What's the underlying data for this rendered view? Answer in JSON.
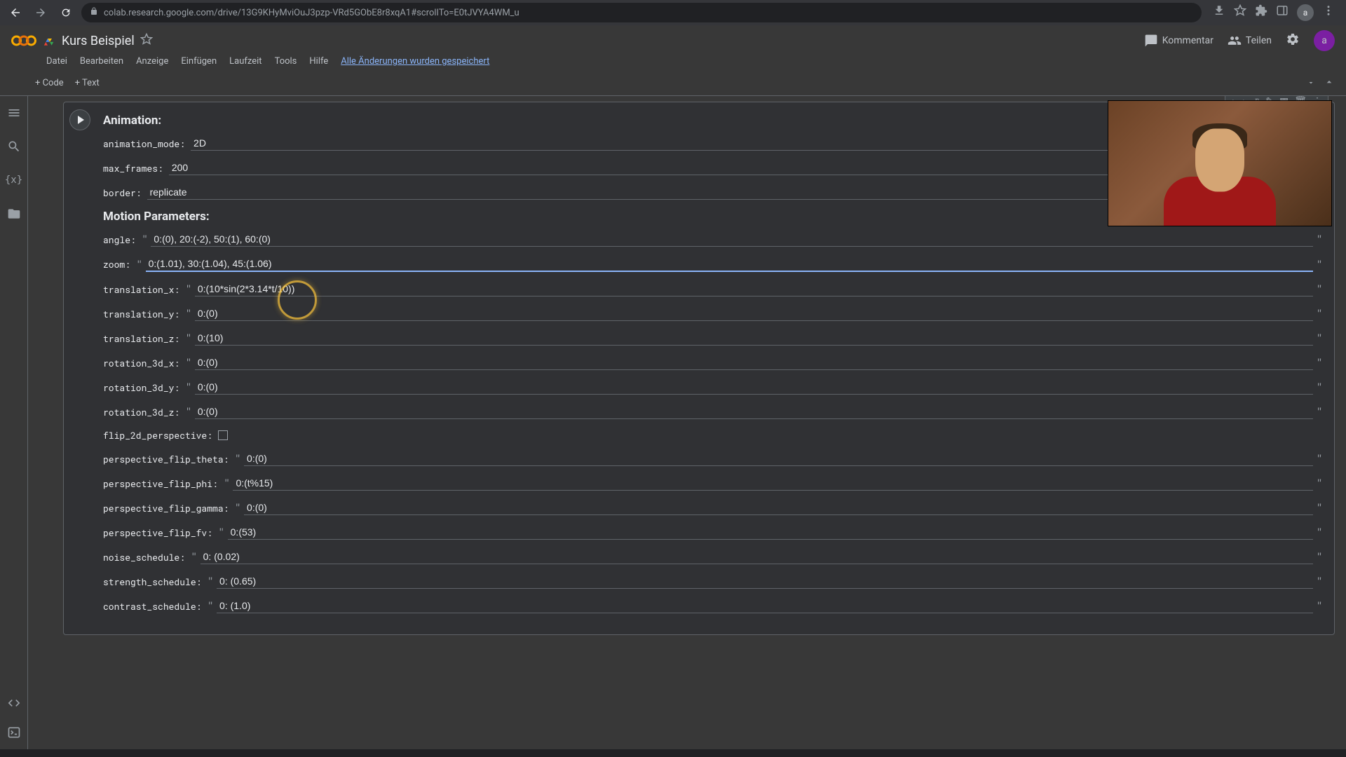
{
  "browser": {
    "url": "colab.research.google.com/drive/13G9KHyMviOuJ3pzp-VRd5GObE8r8xqA1#scrollTo=E0tJVYA4WM_u",
    "avatar": "a"
  },
  "header": {
    "title": "Kurs Beispiel",
    "menus": [
      "Datei",
      "Bearbeiten",
      "Anzeige",
      "Einfügen",
      "Laufzeit",
      "Tools",
      "Hilfe"
    ],
    "saved_text": "Alle Änderungen wurden gespeichert",
    "comment": "Kommentar",
    "share": "Teilen",
    "user": "a"
  },
  "toolbar": {
    "code": "+ Code",
    "text": "+ Text"
  },
  "cell": {
    "section1": "Animation:",
    "section2": "Motion Parameters:",
    "params": {
      "animation_mode": {
        "label": "animation_mode:",
        "value": "2D"
      },
      "max_frames": {
        "label": "max_frames:",
        "value": "200"
      },
      "border": {
        "label": "border:",
        "value": "replicate"
      },
      "angle": {
        "label": "angle:",
        "value": "0:(0), 20:(-2), 50:(1), 60:(0)"
      },
      "zoom": {
        "label": "zoom:",
        "value": "0:(1.01), 30:(1.04), 45:(1.06)"
      },
      "translation_x": {
        "label": "translation_x:",
        "value": "0:(10*sin(2*3.14*t/10))"
      },
      "translation_y": {
        "label": "translation_y:",
        "value": "0:(0)"
      },
      "translation_z": {
        "label": "translation_z:",
        "value": "0:(10)"
      },
      "rotation_3d_x": {
        "label": "rotation_3d_x:",
        "value": "0:(0)"
      },
      "rotation_3d_y": {
        "label": "rotation_3d_y:",
        "value": "0:(0)"
      },
      "rotation_3d_z": {
        "label": "rotation_3d_z:",
        "value": "0:(0)"
      },
      "flip_2d_perspective": {
        "label": "flip_2d_perspective:"
      },
      "perspective_flip_theta": {
        "label": "perspective_flip_theta:",
        "value": "0:(0)"
      },
      "perspective_flip_phi": {
        "label": "perspective_flip_phi:",
        "value": "0:(t%15)"
      },
      "perspective_flip_gamma": {
        "label": "perspective_flip_gamma:",
        "value": "0:(0)"
      },
      "perspective_flip_fv": {
        "label": "perspective_flip_fv:",
        "value": "0:(53)"
      },
      "noise_schedule": {
        "label": "noise_schedule:",
        "value": "0: (0.02)"
      },
      "strength_schedule": {
        "label": "strength_schedule:",
        "value": "0: (0.65)"
      },
      "contrast_schedule": {
        "label": "contrast_schedule:",
        "value": "0: (1.0)"
      }
    }
  }
}
